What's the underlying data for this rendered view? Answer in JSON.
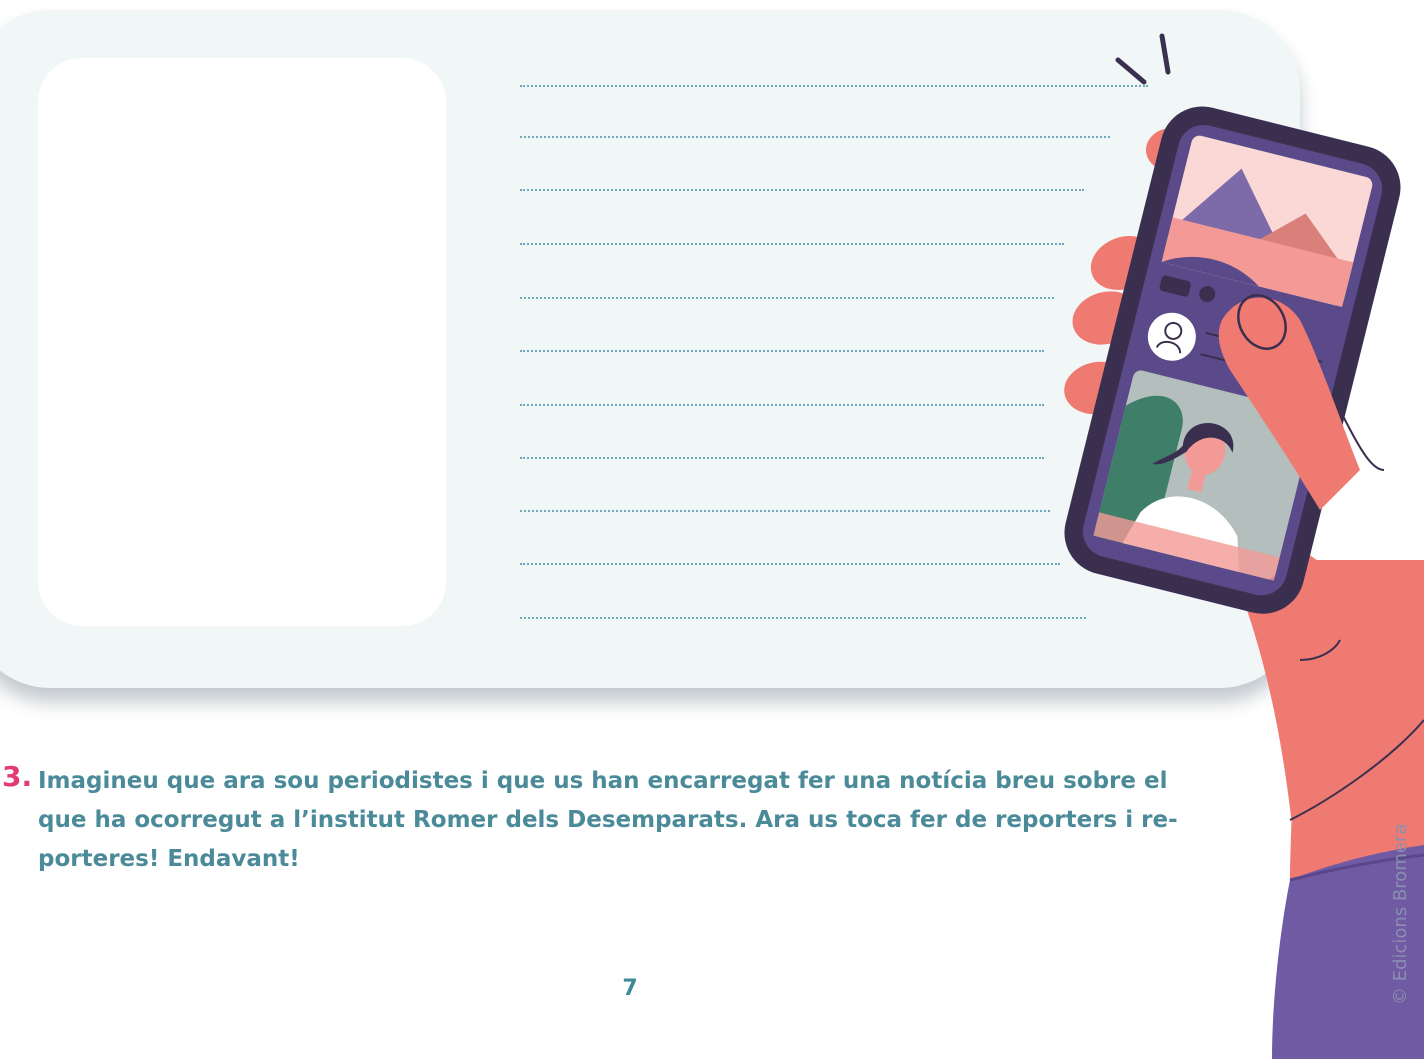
{
  "task": {
    "number": "3.",
    "text": "Imagineu que ara sou periodistes i que us han encarregat fer una notícia breu sobre el que ha ocorregut a l’institut Romer dels Desemparats. Ara us toca fer de reporters i re­porteres! Endavant!"
  },
  "page_number": "7",
  "copyright": "© Edicions Bromera",
  "illustration": {
    "subject": "hand-holding-phone",
    "icons": [
      "user-icon"
    ]
  },
  "colors": {
    "card_background": "#f1f7f7",
    "task_number": "#e23a76",
    "task_text": "#4a8a99",
    "phone_body": "#3a2f4f",
    "hand": "#ef7a72",
    "sleeve": "#6f5aa3"
  }
}
